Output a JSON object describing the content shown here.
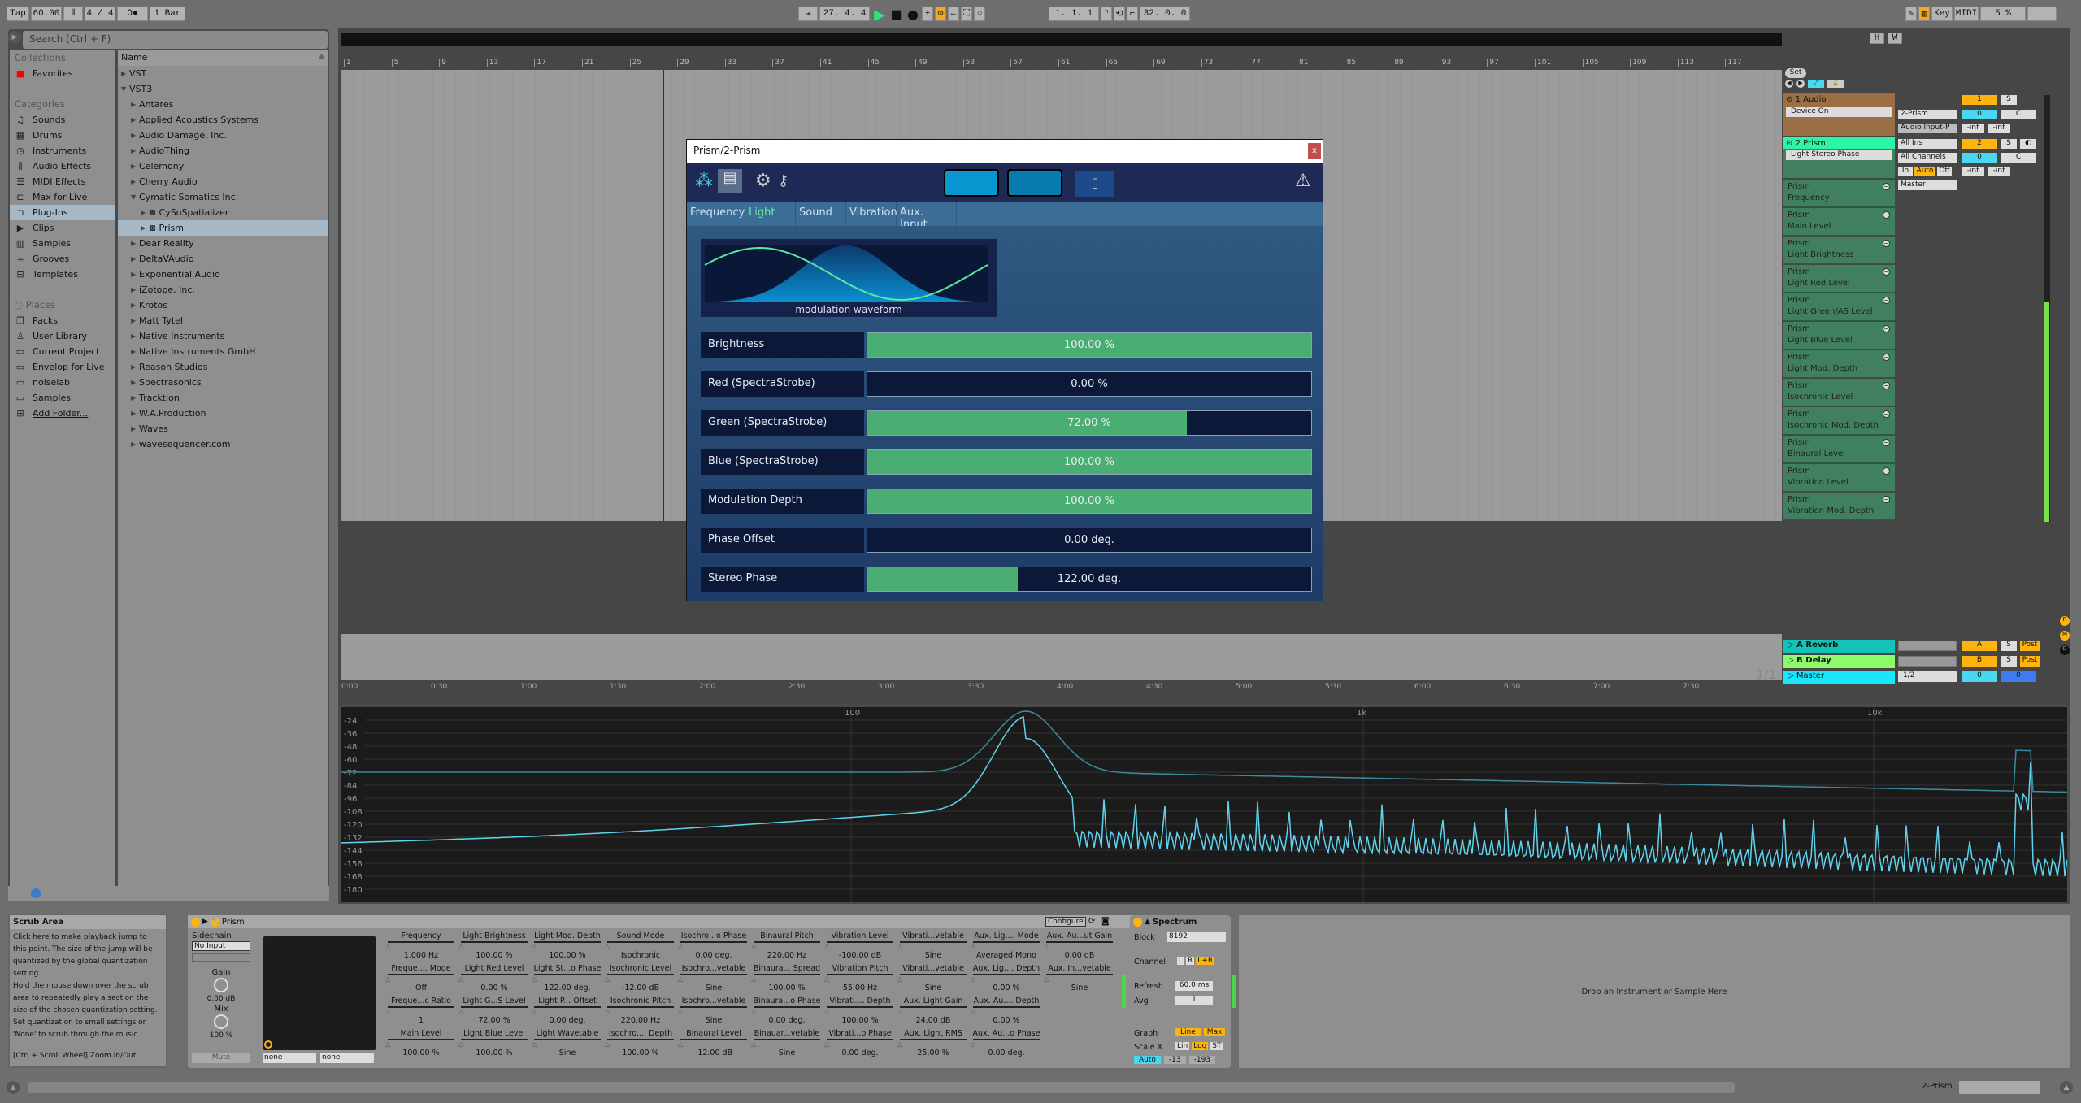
{
  "transport": {
    "tap": "Tap",
    "tempo": "60.00",
    "signature": "4 / 4",
    "metronome": "O●",
    "quantize": "1 Bar",
    "position": "27.  4.  4",
    "loop_start": "1.  1.  1",
    "loop_length": "32.  0.  0",
    "key": "Key",
    "midi": "MIDI",
    "cpu": "5 %"
  },
  "browser": {
    "search_placeholder": "Search (Ctrl + F)",
    "collections_header": "Collections",
    "favorites": "Favorites",
    "categories_header": "Categories",
    "categories": [
      {
        "icon": "note-icon",
        "glyph": "♫",
        "label": "Sounds"
      },
      {
        "icon": "drums-icon",
        "glyph": "▦",
        "label": "Drums"
      },
      {
        "icon": "instrument-icon",
        "glyph": "◷",
        "label": "Instruments"
      },
      {
        "icon": "waveform-icon",
        "glyph": "⫼",
        "label": "Audio Effects"
      },
      {
        "icon": "midi-icon",
        "glyph": "☰",
        "label": "MIDI Effects"
      },
      {
        "icon": "max-icon",
        "glyph": "⊏",
        "label": "Max for Live"
      },
      {
        "icon": "plugin-icon",
        "glyph": "⊐",
        "label": "Plug-Ins"
      },
      {
        "icon": "clip-icon",
        "glyph": "▶",
        "label": "Clips"
      },
      {
        "icon": "sample-icon",
        "glyph": "▥",
        "label": "Samples"
      },
      {
        "icon": "groove-icon",
        "glyph": "≈",
        "label": "Grooves"
      },
      {
        "icon": "template-icon",
        "glyph": "⊟",
        "label": "Templates"
      }
    ],
    "places_header": "Places",
    "places": [
      {
        "icon": "packs-icon",
        "glyph": "❐",
        "label": "Packs"
      },
      {
        "icon": "user-icon",
        "glyph": "♙",
        "label": "User Library"
      },
      {
        "icon": "project-folder-icon",
        "glyph": "▭",
        "label": "Current Project"
      },
      {
        "icon": "folder-icon",
        "glyph": "▭",
        "label": "Envelop for Live"
      },
      {
        "icon": "folder-icon",
        "glyph": "▭",
        "label": "noiselab"
      },
      {
        "icon": "folder-icon",
        "glyph": "▭",
        "label": "Samples"
      },
      {
        "icon": "add-folder-icon",
        "glyph": "⊞",
        "label": "Add Folder..."
      }
    ],
    "name_header": "Name",
    "tree": [
      {
        "label": "VST",
        "depth": 0,
        "open": false
      },
      {
        "label": "VST3",
        "depth": 0,
        "open": true
      },
      {
        "label": "Antares",
        "depth": 1,
        "open": false
      },
      {
        "label": "Applied Acoustics Systems",
        "depth": 1,
        "open": false
      },
      {
        "label": "Audio Damage, Inc.",
        "depth": 1,
        "open": false
      },
      {
        "label": "AudioThing",
        "depth": 1,
        "open": false
      },
      {
        "label": "Celemony",
        "depth": 1,
        "open": false
      },
      {
        "label": "Cherry Audio",
        "depth": 1,
        "open": false
      },
      {
        "label": "Cymatic Somatics Inc.",
        "depth": 1,
        "open": true
      },
      {
        "label": "CySoSpatializer",
        "depth": 2,
        "open": false,
        "plugin": true
      },
      {
        "label": "Prism",
        "depth": 2,
        "open": false,
        "plugin": true,
        "selected": true
      },
      {
        "label": "Dear Reality",
        "depth": 1,
        "open": false
      },
      {
        "label": "DeltaVAudio",
        "depth": 1,
        "open": false
      },
      {
        "label": "Exponential Audio",
        "depth": 1,
        "open": false
      },
      {
        "label": "iZotope, Inc.",
        "depth": 1,
        "open": false
      },
      {
        "label": "Krotos",
        "depth": 1,
        "open": false
      },
      {
        "label": "Matt Tytel",
        "depth": 1,
        "open": false
      },
      {
        "label": "Native Instruments",
        "depth": 1,
        "open": false
      },
      {
        "label": "Native Instruments GmbH",
        "depth": 1,
        "open": false
      },
      {
        "label": "Reason Studios",
        "depth": 1,
        "open": false
      },
      {
        "label": "Spectrasonics",
        "depth": 1,
        "open": false
      },
      {
        "label": "Tracktion",
        "depth": 1,
        "open": false
      },
      {
        "label": "W.A.Production",
        "depth": 1,
        "open": false
      },
      {
        "label": "Waves",
        "depth": 1,
        "open": false
      },
      {
        "label": "wavesequencer.com",
        "depth": 1,
        "open": false
      }
    ]
  },
  "arrangement": {
    "bar_ticks": [
      "1",
      "5",
      "9",
      "13",
      "17",
      "21",
      "25",
      "29",
      "33",
      "37",
      "41",
      "45",
      "49",
      "53",
      "57",
      "61",
      "65",
      "69",
      "73",
      "77",
      "81",
      "85",
      "89",
      "93",
      "97",
      "101",
      "105",
      "109",
      "113",
      "117"
    ],
    "time_ticks": [
      "0:00",
      "0:30",
      "1:00",
      "1:30",
      "2:00",
      "2:30",
      "3:00",
      "3:30",
      "4:00",
      "4:30",
      "5:00",
      "5:30",
      "6:00",
      "6:30",
      "7:00",
      "7:30"
    ],
    "page": "1/1",
    "set_label": "Set",
    "h_label": "H",
    "w_label": "W"
  },
  "plugin_window": {
    "title": "Prism/2-Prism",
    "close": "x",
    "tabs": [
      "Frequency",
      "Light",
      "Sound",
      "Vibration",
      "Aux. Input"
    ],
    "active_tab": "Light",
    "waveform_label": "modulation waveform",
    "params": [
      {
        "label": "Brightness",
        "value": "100.00 %",
        "fill": 1.0
      },
      {
        "label": "Red (SpectraStrobe)",
        "value": "0.00 %",
        "fill": 0.0
      },
      {
        "label": "Green (SpectraStrobe)",
        "value": "72.00 %",
        "fill": 0.72
      },
      {
        "label": "Blue (SpectraStrobe)",
        "value": "100.00 %",
        "fill": 1.0
      },
      {
        "label": "Modulation Depth",
        "value": "100.00 %",
        "fill": 1.0
      },
      {
        "label": "Phase Offset",
        "value": "0.00 deg.",
        "fill": 0.0
      },
      {
        "label": "Stereo Phase",
        "value": "122.00 deg.",
        "fill": 0.339
      }
    ]
  },
  "tracks": {
    "audio": {
      "name": "1 Audio",
      "device": "Device On",
      "input": "2-Prism",
      "input_ch": "Audio Input-P",
      "number": "1",
      "solo": "S",
      "vol": "0",
      "pan": "C",
      "peak_l": "-inf",
      "peak_r": "-inf",
      "color": "#9b6f46"
    },
    "prism": {
      "name": "2 Prism",
      "device": "Light Stereo Phase",
      "input": "All Ins",
      "input_ch": "All Channels",
      "monitor": [
        "In",
        "Auto",
        "Off"
      ],
      "output": "Master",
      "number": "2",
      "solo": "S",
      "vol": "0",
      "pan": "C",
      "peak_l": "-inf",
      "peak_r": "-inf",
      "color": "#2bf5a6"
    },
    "automation_lanes": [
      {
        "device": "Prism",
        "param": "Frequency"
      },
      {
        "device": "Prism",
        "param": "Main Level"
      },
      {
        "device": "Prism",
        "param": "Light Brightness"
      },
      {
        "device": "Prism",
        "param": "Light Red Level"
      },
      {
        "device": "Prism",
        "param": "Light Green/AS Level"
      },
      {
        "device": "Prism",
        "param": "Light Blue Level"
      },
      {
        "device": "Prism",
        "param": "Light Mod. Depth"
      },
      {
        "device": "Prism",
        "param": "Isochronic Level"
      },
      {
        "device": "Prism",
        "param": "Isochronic Mod. Depth"
      },
      {
        "device": "Prism",
        "param": "Binaural Level"
      },
      {
        "device": "Prism",
        "param": "Vibration Level"
      },
      {
        "device": "Prism",
        "param": "Vibration Mod. Depth"
      }
    ],
    "returns": [
      {
        "name": "A Reverb",
        "letter": "A",
        "solo": "S",
        "post": "Post",
        "color": "#12c3b8"
      },
      {
        "name": "B Delay",
        "letter": "B",
        "solo": "S",
        "post": "Post",
        "color": "#8dfa6a"
      }
    ],
    "master": {
      "name": "Master",
      "output": "1/2",
      "vol": "0",
      "cue": "0",
      "color": "#18e6fa"
    },
    "side_buttons": [
      "R",
      "M",
      "D"
    ]
  },
  "spectrum_display": {
    "x_labels": [
      "100",
      "1k",
      "10k"
    ],
    "y_labels": [
      "-24",
      "-36",
      "-48",
      "-60",
      "-72",
      "-84",
      "-96",
      "-108",
      "-120",
      "-132",
      "-144",
      "-156",
      "-168",
      "-180"
    ]
  },
  "info_panel": {
    "title": "Scrub Area",
    "body": "Click here to make playback jump to this point. The size of the jump will be quantized by the global quantization setting.\nHold the mouse down over the scrub area to repeatedly play a section the size of the chosen quantization setting. Set quantization to small settings or 'None' to scrub through the music.",
    "shortcut": "[Ctrl + Scroll Wheel] Zoom In/Out"
  },
  "prism_device": {
    "name": "Prism",
    "sidechain_label": "Sidechain",
    "sidechain_input": "No Input",
    "gain_label": "Gain",
    "gain_value": "0.00 dB",
    "mix_label": "Mix",
    "mix_value": "100 %",
    "mute": "Mute",
    "xy_x": "none",
    "xy_y": "none",
    "configure": "Configure",
    "columns": [
      [
        {
          "l": "Frequency",
          "v": "1.000 Hz"
        },
        {
          "l": "Freque.... Mode",
          "v": "Off"
        },
        {
          "l": "Freque...c Ratio",
          "v": "1"
        },
        {
          "l": "Main Level",
          "v": "100.00 %"
        }
      ],
      [
        {
          "l": "Light Brightness",
          "v": "100.00 %"
        },
        {
          "l": "Light Red Level",
          "v": "0.00 %"
        },
        {
          "l": "Light G...S Level",
          "v": "72.00 %"
        },
        {
          "l": "Light Blue Level",
          "v": "100.00 %"
        }
      ],
      [
        {
          "l": "Light Mod. Depth",
          "v": "100.00 %"
        },
        {
          "l": "Light St...o Phase",
          "v": "122.00 deg."
        },
        {
          "l": "Light P... Offset",
          "v": "0.00 deg."
        },
        {
          "l": "Light Wavetable",
          "v": "Sine"
        }
      ],
      [
        {
          "l": "Sound Mode",
          "v": "Isochronic"
        },
        {
          "l": "Isochronic Level",
          "v": "-12.00 dB"
        },
        {
          "l": "Isochronic Pitch",
          "v": "220.00 Hz"
        },
        {
          "l": "Isochro.... Depth",
          "v": "100.00 %"
        }
      ],
      [
        {
          "l": "Isochro...o Phase",
          "v": "0.00 deg."
        },
        {
          "l": "Isochro...vetable",
          "v": "Sine"
        },
        {
          "l": "Isochro...vetable",
          "v": "Sine"
        },
        {
          "l": "Binaural Level",
          "v": "-12.00 dB"
        }
      ],
      [
        {
          "l": "Binaural Pitch",
          "v": "220.00 Hz"
        },
        {
          "l": "Binaura... Spread",
          "v": "100.00 %"
        },
        {
          "l": "Binaura...o Phase",
          "v": "0.00 deg."
        },
        {
          "l": "Binauar...vetable",
          "v": "Sine"
        }
      ],
      [
        {
          "l": "Vibration Level",
          "v": "-100.00 dB"
        },
        {
          "l": "Vibration Pitch",
          "v": "55.00 Hz"
        },
        {
          "l": "Vibrati.... Depth",
          "v": "100.00 %"
        },
        {
          "l": "Vibrati...o Phase",
          "v": "0.00 deg."
        }
      ],
      [
        {
          "l": "Vibrati...vetable",
          "v": "Sine"
        },
        {
          "l": "Vibrati...vetable",
          "v": "Sine"
        },
        {
          "l": "Aux. Light Gain",
          "v": "24.00 dB"
        },
        {
          "l": "Aux. Light RMS",
          "v": "25.00 %"
        }
      ],
      [
        {
          "l": "Aux. Lig.... Mode",
          "v": "Averaged Mono"
        },
        {
          "l": "Aux. Lig.... Depth",
          "v": "0.00 %"
        },
        {
          "l": "Aux. Au.... Depth",
          "v": "0.00 %"
        },
        {
          "l": "Aux. Au...o Phase",
          "v": "0.00 deg."
        }
      ],
      [
        {
          "l": "Aux. Au...ut Gain",
          "v": "0.00 dB"
        },
        {
          "l": "Aux. In...vetable",
          "v": "Sine"
        }
      ]
    ]
  },
  "spectrum_device": {
    "name": "Spectrum",
    "block_label": "Block",
    "block": "8192",
    "channel_label": "Channel",
    "channels": [
      "L",
      "R",
      "L+R"
    ],
    "refresh_label": "Refresh",
    "refresh": "60.0 ms",
    "avg_label": "Avg",
    "avg": "1",
    "graph_label": "Graph",
    "graph": [
      "Line",
      "Max"
    ],
    "scalex_label": "Scale X",
    "scalex": [
      "Lin",
      "Log",
      "ST"
    ],
    "auto": "Auto",
    "range_lo": "-13",
    "range_hi": "-193"
  },
  "drop_area": "Drop an Instrument or Sample Here",
  "statusbar": {
    "track": "2-Prism"
  }
}
